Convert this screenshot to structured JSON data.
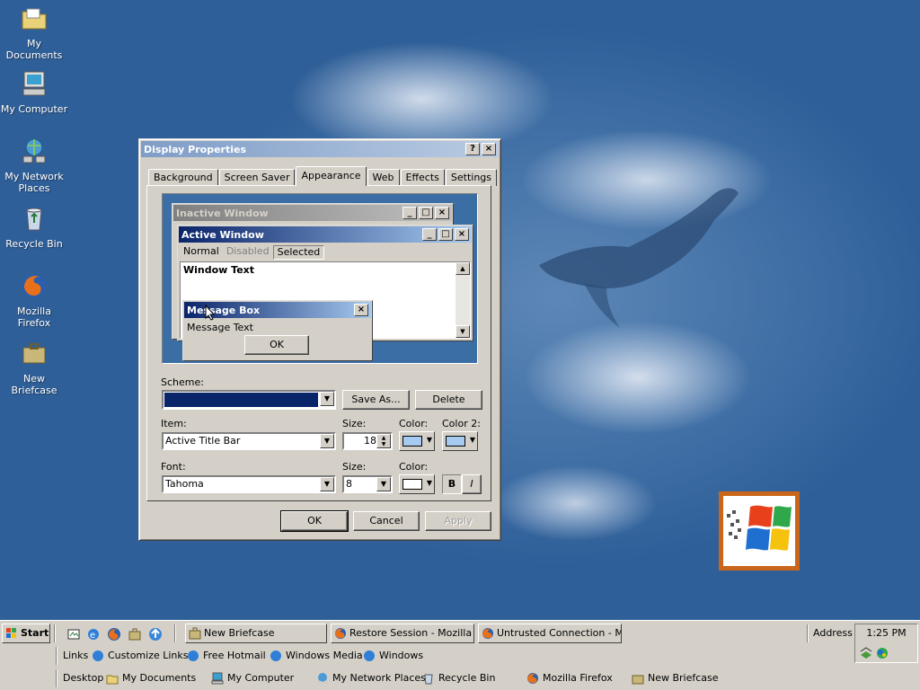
{
  "desktop": {
    "icons": [
      {
        "label": "My Documents",
        "icon": "folder-documents-icon"
      },
      {
        "label": "My Computer",
        "icon": "computer-icon"
      },
      {
        "label": "My Network Places",
        "icon": "network-places-icon"
      },
      {
        "label": "Recycle Bin",
        "icon": "recycle-bin-icon"
      },
      {
        "label": "Mozilla Firefox",
        "icon": "firefox-icon"
      },
      {
        "label": "New Briefcase",
        "icon": "briefcase-icon"
      }
    ]
  },
  "dialog": {
    "title": "Display Properties",
    "help_btn": "?",
    "close_btn": "×",
    "tabs": [
      "Background",
      "Screen Saver",
      "Appearance",
      "Web",
      "Effects",
      "Settings"
    ],
    "active_tab": "Appearance",
    "preview": {
      "inactive_title": "Inactive Window",
      "active_title": "Active Window",
      "menu": [
        "Normal",
        "Disabled",
        "Selected"
      ],
      "window_text": "Window Text",
      "msgbox_title": "Message Box",
      "msgbox_text": "Message Text",
      "msgbox_ok": "OK"
    },
    "scheme_label": "Scheme:",
    "scheme_value": "",
    "save_as": "Save As...",
    "delete": "Delete",
    "item_label": "Item:",
    "item_value": "Active Title Bar",
    "item_size_label": "Size:",
    "item_size_value": "18",
    "color_label": "Color:",
    "color2_label": "Color 2:",
    "font_label": "Font:",
    "font_value": "Tahoma",
    "font_size_label": "Size:",
    "font_size_value": "8",
    "font_color_label": "Color:",
    "bold": "B",
    "italic": "I",
    "ok": "OK",
    "cancel": "Cancel",
    "apply": "Apply",
    "colors": {
      "item_color": "#a6caf0",
      "item_color2": "#a6caf0",
      "font_color": "#ffffff",
      "scheme_selection": "#0a246a"
    }
  },
  "taskbar": {
    "start": "Start",
    "tasks": [
      "New Briefcase",
      "Restore Session - Mozilla ...",
      "Untrusted Connection - M..."
    ],
    "address_label": "Address",
    "clock": "1:25 PM",
    "links_label": "Links",
    "links": [
      "Customize Links",
      "Free Hotmail",
      "Windows Media",
      "Windows"
    ],
    "desktop_label": "Desktop",
    "desktop_items": [
      "My Documents",
      "My Computer",
      "My Network Places",
      "Recycle Bin",
      "Mozilla Firefox",
      "New Briefcase"
    ]
  }
}
